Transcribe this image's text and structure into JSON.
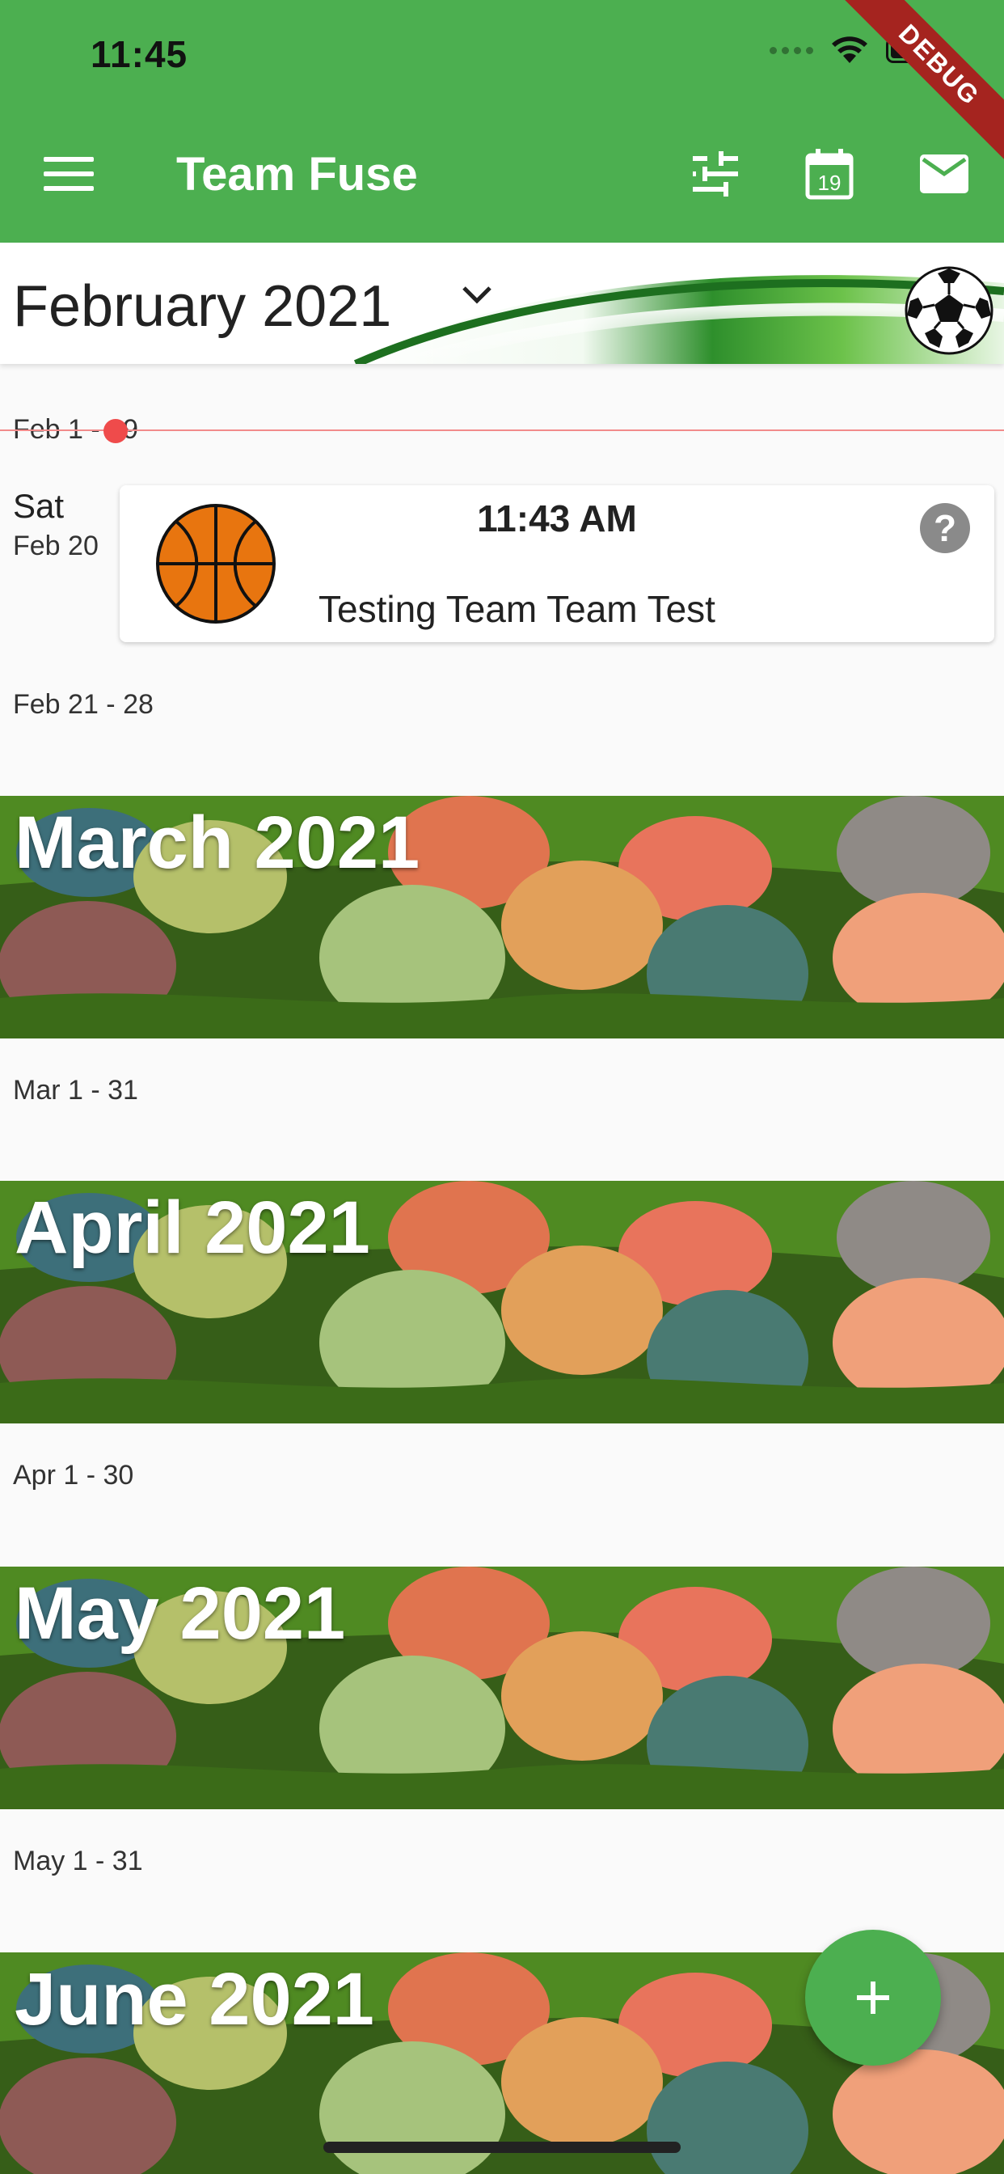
{
  "status_bar": {
    "time": "11:45"
  },
  "debug_banner": "DEBUG",
  "app_bar": {
    "title": "Team Fuse",
    "calendar_day": "19",
    "colors": {
      "primary": "#4caf50",
      "on_primary": "#ffffff"
    }
  },
  "current_month": {
    "title": "February 2021"
  },
  "weeks": {
    "feb_1": "Feb 1 - 19",
    "feb_2": "Feb 21 - 28",
    "mar": "Mar 1 - 31",
    "apr": "Apr 1 - 30",
    "may": "May 1 - 31"
  },
  "event": {
    "day_name": "Sat",
    "day_date": "Feb 20",
    "time": "11:43 AM",
    "name": "Testing Team Team Test",
    "sport_icon": "basketball-icon",
    "status": "?"
  },
  "months": {
    "march": "March 2021",
    "april": "April 2021",
    "may": "May 2021",
    "june": "June 2021"
  },
  "fab": {
    "icon": "+"
  }
}
